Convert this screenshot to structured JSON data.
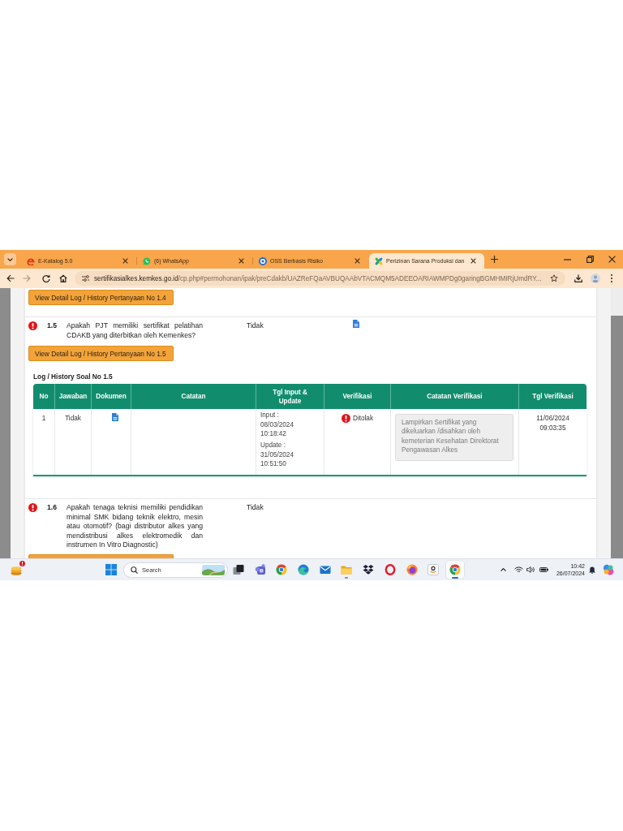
{
  "browser": {
    "tabs": [
      {
        "kind": "swirl",
        "title": "E-Katalog 5.0",
        "selected": false
      },
      {
        "kind": "chat",
        "title": "(6) WhatsApp",
        "selected": false
      },
      {
        "kind": "ring",
        "title": "OSS Berbasis Risiko",
        "selected": false
      },
      {
        "kind": "pinwheel",
        "title": "Perizinan Sarana Produksi dan",
        "selected": true
      }
    ],
    "address": {
      "host": "sertifikasialkes.kemkes.go.id",
      "path": "/cp.php#permohonan/ipak/preCdakb/UAZReFQaAVBUQAAbVTACMQM5ADEEOARIAWMPDg0garingBGMHMIRjUmdRY..."
    }
  },
  "page": {
    "questions": [
      {
        "button": "View Detail Log / History Pertanyaan No 1.4"
      },
      {
        "rejected": true,
        "number": "1.5",
        "text": "Apakah PJT memiliki sertifikat pelatihan CDAKB yang diterbitkan oleh Kemenkes?",
        "answer": "Tidak",
        "document": true,
        "button": "View Detail Log / History Pertanyaan No 1.5",
        "log": {
          "title": "Log / History Soal No 1.5",
          "columns": [
            "No",
            "Jawaban",
            "Dokumen",
            "Catatan",
            "Tgl Input & Update",
            "Verifikasi",
            "Catatan Verifikasi",
            "Tgl Verifikasi"
          ],
          "rows": [
            {
              "no": "1",
              "answer": "Tidak",
              "document": true,
              "input": {
                "label": "Input :",
                "date": "08/03/2024",
                "time": "10:18:42"
              },
              "update": {
                "label": "Update :",
                "date": "31/05/2024",
                "time": "10:51:50"
              },
              "verification": {
                "rejected": true,
                "label": "Ditolak"
              },
              "verification_note": "Lampirkan Sertifikat yang dikeluarkan /disahkan oleh kemeterian Kesehatan Direktorat Pengawasan Alkes",
              "verified_at": {
                "date": "11/06/2024",
                "time": "09:03:35"
              }
            }
          ]
        }
      },
      {
        "rejected": true,
        "number": "1.6",
        "text": "Apakah tenaga teknisi memiliki pendidikan minimal SMK bidang teknik elektro, mesin atau otomotif? (bagi distributor alkes yang mendistribusi alkes elektromedik dan instrumen In Vitro Diagnostic)",
        "answer": "Tidak",
        "button_cut": true
      }
    ]
  },
  "taskbar": {
    "search": {
      "placeholder": "Search"
    },
    "apps": [
      {
        "kind": "taskview",
        "running": false,
        "selected": false
      },
      {
        "kind": "people",
        "running": false,
        "selected": false
      },
      {
        "kind": "browser",
        "running": false,
        "selected": false
      },
      {
        "kind": "wave",
        "running": false,
        "selected": false
      },
      {
        "kind": "mail",
        "running": false,
        "selected": false
      },
      {
        "kind": "folder",
        "running": true,
        "selected": false
      },
      {
        "kind": "diamonds",
        "running": false,
        "selected": false
      },
      {
        "kind": "ring",
        "running": false,
        "selected": false
      },
      {
        "kind": "globe",
        "running": false,
        "selected": false
      },
      {
        "kind": "smile",
        "running": false,
        "selected": false
      },
      {
        "kind": "browser",
        "running": true,
        "selected": true
      }
    ],
    "clock": {
      "time": "10:42",
      "date": "26/07/2024"
    }
  }
}
